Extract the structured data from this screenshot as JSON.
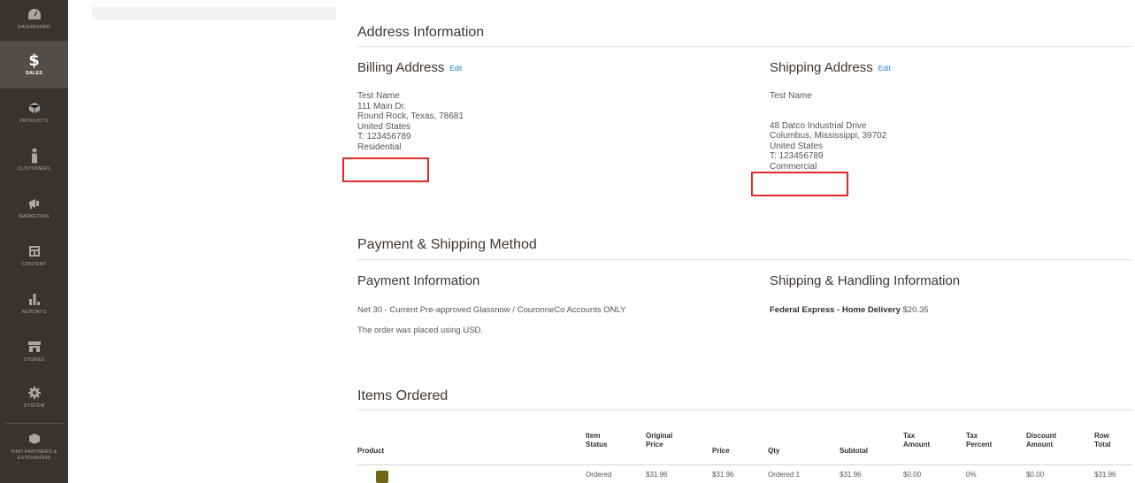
{
  "sidebar": {
    "items": [
      {
        "label": "Dashboard",
        "icon": "dashboard-icon"
      },
      {
        "label": "Sales",
        "icon": "dollar-icon",
        "active": true
      },
      {
        "label": "Products",
        "icon": "cube-icon"
      },
      {
        "label": "Customers",
        "icon": "person-icon"
      },
      {
        "label": "Marketing",
        "icon": "megaphone-icon"
      },
      {
        "label": "Content",
        "icon": "layout-icon"
      },
      {
        "label": "Reports",
        "icon": "bar-chart-icon"
      },
      {
        "label": "Stores",
        "icon": "store-icon"
      },
      {
        "label": "System",
        "icon": "gear-icon"
      },
      {
        "label": "Find Partners & Extensions",
        "icon": "box-icon"
      }
    ]
  },
  "address_info": {
    "title": "Address Information",
    "billing": {
      "title": "Billing Address",
      "edit": "Edit",
      "lines": [
        "Test Name",
        "111 Main Dr.",
        "Round Rock, Texas, 78681",
        "United States",
        "T: 123456789",
        "Residential"
      ]
    },
    "shipping": {
      "title": "Shipping Address",
      "edit": "Edit",
      "lines": [
        "Test Name",
        "",
        "48 Datco Industrial Drive",
        "Columbus, Mississippi, 39702",
        "United States",
        "T: 123456789",
        "Commercial"
      ]
    }
  },
  "payment_shipping": {
    "title": "Payment & Shipping Method",
    "payment_title": "Payment Information",
    "payment_method": "Net 30 - Current Pre-approved Glassnow / CouronneCo Accounts ONLY",
    "currency_note": "The order was placed using USD.",
    "shipping_title": "Shipping & Handling Information",
    "shipping_method": "Federal Express - Home Delivery",
    "shipping_price": "$20.35"
  },
  "items_ordered": {
    "title": "Items Ordered",
    "columns": [
      {
        "label": "Product"
      },
      {
        "label": "Item\nStatus"
      },
      {
        "label": "Original\nPrice"
      },
      {
        "label": "Price"
      },
      {
        "label": "Qty"
      },
      {
        "label": "Subtotal"
      },
      {
        "label": "Tax\nAmount"
      },
      {
        "label": "Tax\nPercent"
      },
      {
        "label": "Discount\nAmount"
      },
      {
        "label": "Row\nTotal"
      }
    ],
    "row": {
      "status": "Ordered",
      "original_price": "$31.96",
      "price": "$31.96",
      "qty": "Ordered 1",
      "subtotal": "$31.96",
      "tax_amount": "$0.00",
      "tax_percent": "0%",
      "discount": "$0.00",
      "row_total": "$31.96"
    }
  },
  "colors": {
    "sidebar_bg": "#373330",
    "active_bg": "#524d49",
    "link": "#1979c3",
    "highlight": "#e02b27"
  }
}
